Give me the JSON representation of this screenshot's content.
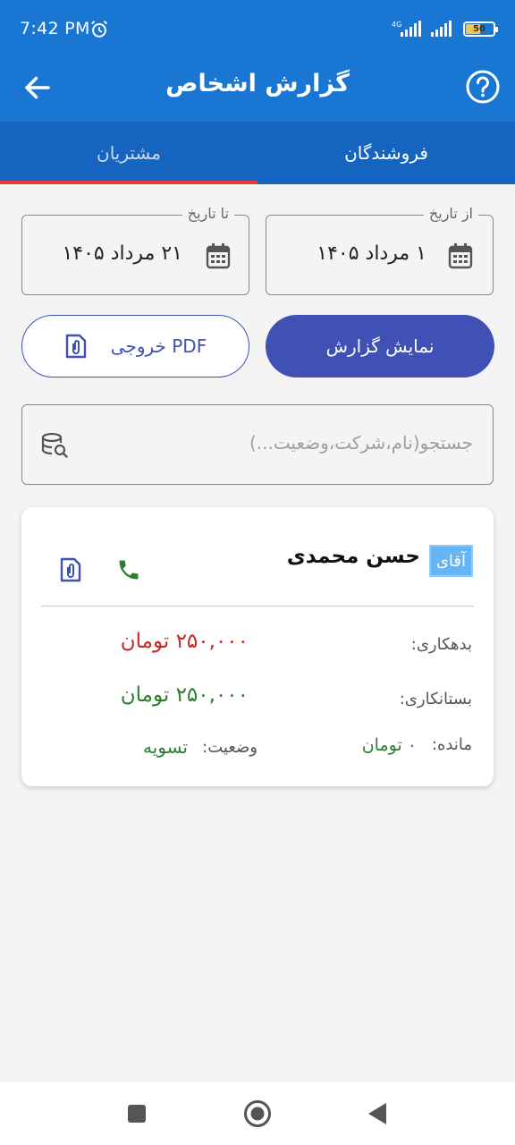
{
  "status_bar": {
    "time": "7:42 PM",
    "network": "4G",
    "battery": "50"
  },
  "app_bar": {
    "title": "گزارش اشخاص"
  },
  "tabs": [
    {
      "label": "فروشندگان",
      "active": true
    },
    {
      "label": "مشتریان",
      "active": false
    }
  ],
  "filters": {
    "from_label": "از تاریخ",
    "from_value": "۱ مرداد ۱۴۰۵",
    "to_label": "تا تاریخ",
    "to_value": "۲۱ مرداد ۱۴۰۵"
  },
  "actions": {
    "show_report": "نمایش گزارش",
    "pdf_export": "خروجی PDF"
  },
  "search": {
    "placeholder": "جستجو(نام،شرکت،وضعیت...)"
  },
  "person": {
    "honorific": "آقای",
    "name": "حسن محمدی",
    "debit_label": "بدهکاری:",
    "debit_value": "۲۵۰,۰۰۰ تومان",
    "credit_label": "بستانکاری:",
    "credit_value": "۲۵۰,۰۰۰ تومان",
    "balance_label": "مانده:",
    "balance_value": "۰ تومان",
    "status_label": "وضعیت:",
    "status_value": "تسویه"
  },
  "colors": {
    "primary": "#1976d2",
    "button": "#3f51b5",
    "debit": "#c62828",
    "credit": "#2e7d32",
    "tab_indicator": "#e53935"
  }
}
